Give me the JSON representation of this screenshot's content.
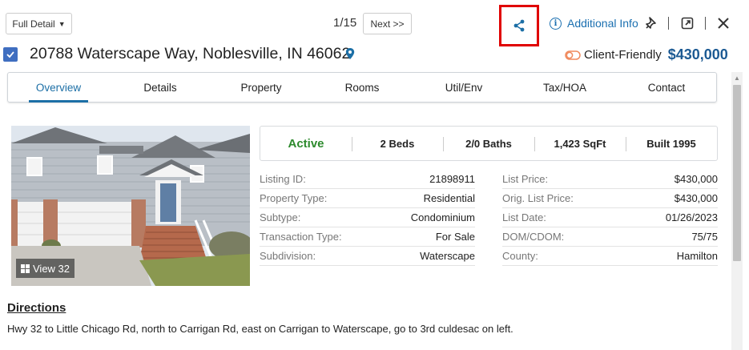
{
  "toolbar": {
    "view_mode": "Full Detail",
    "pager": "1/15",
    "next_label": "Next >>",
    "additional_info": "Additional Info"
  },
  "listing": {
    "address": "20788 Waterscape Way, Noblesville, IN 46062",
    "client_friendly_label": "Client-Friendly",
    "price": "$430,000"
  },
  "tabs": [
    "Overview",
    "Details",
    "Property",
    "Rooms",
    "Util/Env",
    "Tax/HOA",
    "Contact"
  ],
  "active_tab": "Overview",
  "photo": {
    "view_label": "View 32"
  },
  "summary": {
    "status": "Active",
    "beds": "2 Beds",
    "baths": "2/0 Baths",
    "sqft": "1,423 SqFt",
    "built": "Built 1995"
  },
  "facts_left": [
    {
      "label": "Listing ID:",
      "value": "21898911"
    },
    {
      "label": "Property Type:",
      "value": "Residential"
    },
    {
      "label": "Subtype:",
      "value": "Condominium"
    },
    {
      "label": "Transaction Type:",
      "value": "For Sale"
    },
    {
      "label": "Subdivision:",
      "value": "Waterscape"
    }
  ],
  "facts_right": [
    {
      "label": "List Price:",
      "value": "$430,000"
    },
    {
      "label": "Orig. List Price:",
      "value": "$430,000"
    },
    {
      "label": "List Date:",
      "value": "01/26/2023"
    },
    {
      "label": "DOM/CDOM:",
      "value": "75/75"
    },
    {
      "label": "County:",
      "value": "Hamilton"
    }
  ],
  "directions": {
    "title": "Directions",
    "text": "Hwy 32 to Little Chicago Rd, north to Carrigan Rd, east on Carrigan to Waterscape, go to 3rd culdesac on left."
  },
  "colors": {
    "accent": "#1c6fa6",
    "price": "#1c5a93",
    "status_active": "#2d8a2d",
    "highlight_box": "#e00000",
    "checkbox": "#3f6ec0"
  },
  "icons": [
    "share-icon",
    "info-icon",
    "pin-off-icon",
    "open-external-icon",
    "close-icon",
    "map-pin-icon",
    "client-friendly-toggle-icon",
    "photo-grid-icon"
  ]
}
